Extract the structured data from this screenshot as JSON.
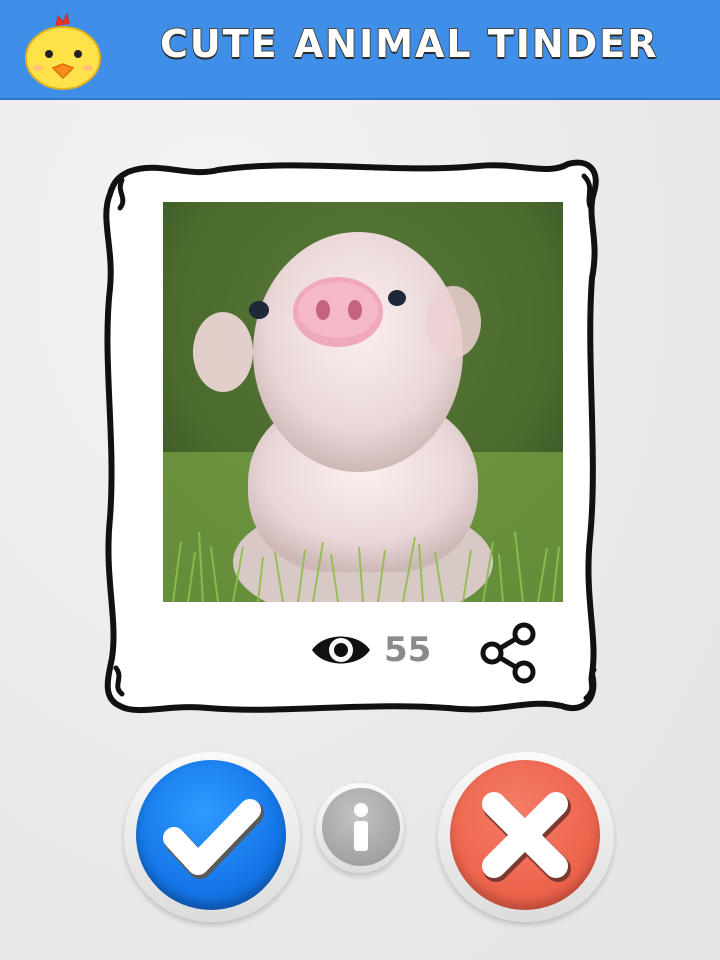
{
  "header": {
    "title": "Cute Animal Tinder",
    "background_color": "#3f8fe8",
    "logo_icon": "chick-icon"
  },
  "card": {
    "photo_subject": "piglet-photo",
    "view_count": "55",
    "view_icon": "eye-icon",
    "share_icon": "share-icon"
  },
  "actions": {
    "like_icon": "checkmark-icon",
    "like_color": "#1476e8",
    "info_icon": "info-icon",
    "info_color": "#a3a3a3",
    "nope_icon": "close-icon",
    "nope_color": "#ee654e"
  }
}
